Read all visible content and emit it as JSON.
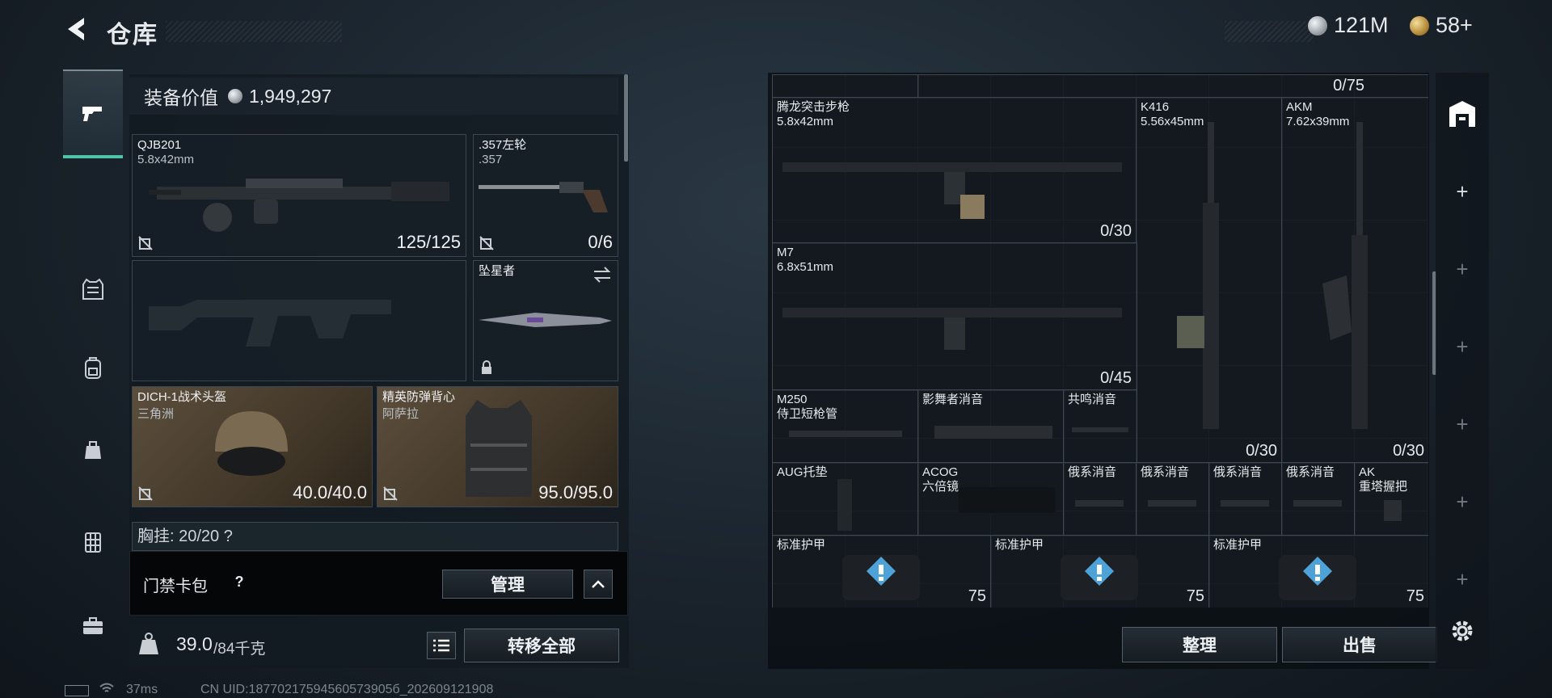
{
  "header": {
    "title": "仓库",
    "currency_silver": "121M",
    "currency_gold": "58+"
  },
  "nav": {
    "items": [
      "weapons",
      "armor",
      "backpack",
      "bag",
      "chest-rig",
      "toolbox"
    ]
  },
  "left": {
    "equip_value_label": "装备价值",
    "equip_value": "1,949,297",
    "primary": {
      "name": "QJB201",
      "ammo": "5.8x42mm",
      "count": "125/125"
    },
    "sidearm": {
      "name": ".357左轮",
      "ammo": ".357",
      "count": "0/6"
    },
    "melee": {
      "name": "坠星者"
    },
    "helmet": {
      "name": "DICH-1战术头盔",
      "sub": "三角洲",
      "count": "40.0/40.0"
    },
    "vest": {
      "name": "精英防弹背心",
      "sub": "阿萨拉",
      "count": "95.0/95.0"
    },
    "chest_partial": "胸挂: 20/20 ?",
    "card_label": "门禁卡包",
    "card_help": "?",
    "manage": "管理",
    "weight": "39.0",
    "weight_max": "/84千克",
    "transfer_all": "转移全部"
  },
  "right": {
    "top_count": "0/75",
    "items": [
      {
        "name": "腾龙突击步枪",
        "sub": "5.8x42mm",
        "count": "0/30"
      },
      {
        "name": "K416",
        "sub": "5.56x45mm",
        "count": "0/30"
      },
      {
        "name": "AKM",
        "sub": "7.62x39mm",
        "count": "0/30"
      },
      {
        "name": "M7",
        "sub": "6.8x51mm",
        "count": "0/45"
      },
      {
        "name": "M250",
        "sub": "侍卫短枪管"
      },
      {
        "name": "影舞者消音",
        "sub": ""
      },
      {
        "name": "共鸣消音",
        "sub": ""
      },
      {
        "name": "AUG托垫",
        "sub": ""
      },
      {
        "name": "ACOG",
        "sub": "六倍镜"
      },
      {
        "name": "俄系消音",
        "sub": ""
      },
      {
        "name": "俄系消音",
        "sub": ""
      },
      {
        "name": "俄系消音",
        "sub": ""
      },
      {
        "name": "俄系消音",
        "sub": ""
      },
      {
        "name": "AK",
        "sub": "重塔握把"
      },
      {
        "name": "标准护甲",
        "count": "75"
      },
      {
        "name": "标准护甲",
        "count": "75"
      },
      {
        "name": "标准护甲",
        "count": "75"
      }
    ],
    "sort": "整理",
    "sell": "出售"
  },
  "status": {
    "ping": "37ms",
    "uid": "CN UID:18770217594560573905б_202609121908"
  }
}
